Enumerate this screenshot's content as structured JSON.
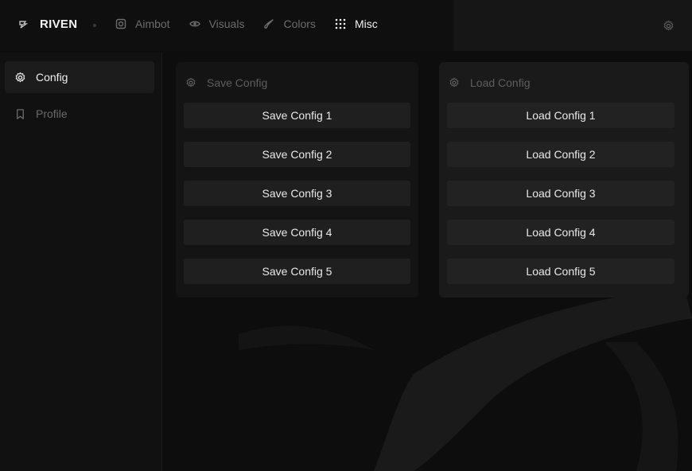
{
  "brand": {
    "name": "RIVEN",
    "logo_icon": "riven-logo-icon"
  },
  "nav": {
    "items": [
      {
        "label": "Aimbot",
        "icon": "crosshair-box-icon",
        "active": false
      },
      {
        "label": "Visuals",
        "icon": "eye-icon",
        "active": false
      },
      {
        "label": "Colors",
        "icon": "brush-icon",
        "active": false
      },
      {
        "label": "Misc",
        "icon": "grid-dots-icon",
        "active": true
      }
    ],
    "settings_icon": "gear-icon"
  },
  "sidebar": {
    "items": [
      {
        "label": "Config",
        "icon": "gear-icon",
        "active": true
      },
      {
        "label": "Profile",
        "icon": "bookmark-icon",
        "active": false
      }
    ]
  },
  "save_panel": {
    "title": "Save Config",
    "icon": "gear-icon",
    "buttons": [
      "Save Config 1",
      "Save Config 2",
      "Save Config 3",
      "Save Config 4",
      "Save Config 5"
    ]
  },
  "load_panel": {
    "title": "Load Config",
    "icon": "gear-icon",
    "buttons": [
      "Load Config 1",
      "Load Config 2",
      "Load Config 3",
      "Load Config 4",
      "Load Config 5"
    ]
  },
  "colors": {
    "accent_text": "#f0f0f0",
    "muted_text": "#6a6a6a",
    "background": "#0d0d0d"
  }
}
